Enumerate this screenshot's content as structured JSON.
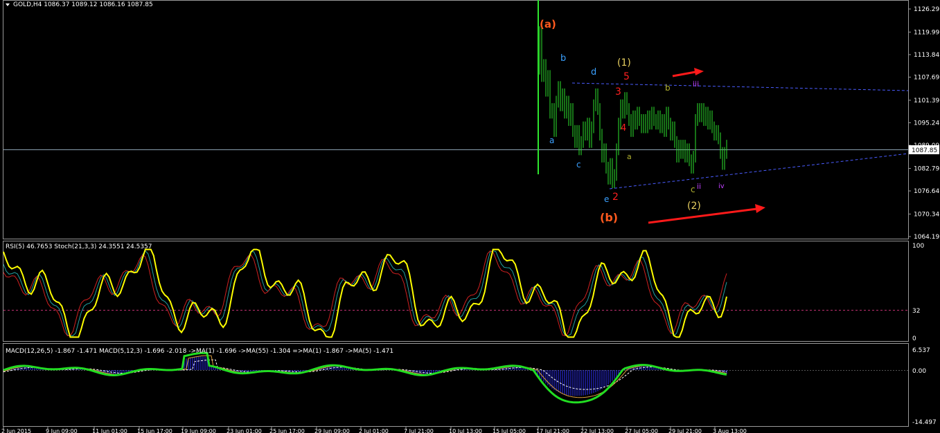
{
  "window": {
    "symbol_header": "GOLD,H4  1086.37 1089.12 1086.16 1087.85"
  },
  "price_panel": {
    "current_price": "1087.85",
    "price_levels": [
      {
        "label": "1126.29",
        "value": 1126.29
      },
      {
        "label": "1119.99",
        "value": 1119.99
      },
      {
        "label": "1113.84",
        "value": 1113.84
      },
      {
        "label": "1107.69",
        "value": 1107.69
      },
      {
        "label": "1101.39",
        "value": 1101.39
      },
      {
        "label": "1095.24",
        "value": 1095.24
      },
      {
        "label": "1089.09",
        "value": 1089.09
      },
      {
        "label": "1082.79",
        "value": 1082.79
      },
      {
        "label": "1076.64",
        "value": 1076.64
      },
      {
        "label": "1070.34",
        "value": 1070.34
      },
      {
        "label": "1064.19",
        "value": 1064.19
      }
    ],
    "wave_labels": [
      {
        "text": "(a)",
        "color": "#ff5a1e"
      },
      {
        "text": "b",
        "color": "#3aa0ff"
      },
      {
        "text": "a",
        "color": "#3aa0ff"
      },
      {
        "text": "d",
        "color": "#3aa0ff"
      },
      {
        "text": "c",
        "color": "#3aa0ff"
      },
      {
        "text": "e",
        "color": "#3aa0ff"
      },
      {
        "text": "(b)",
        "color": "#ff5a1e"
      },
      {
        "text": "(1)",
        "color": "#e8d060"
      },
      {
        "text": "5",
        "color": "#ff2020"
      },
      {
        "text": "3",
        "color": "#ff2020"
      },
      {
        "text": "4",
        "color": "#ff2020"
      },
      {
        "text": "2",
        "color": "#ff2020"
      },
      {
        "text": "a",
        "color": "#b0b030"
      },
      {
        "text": "b",
        "color": "#b0b030"
      },
      {
        "text": "c",
        "color": "#b0b030"
      },
      {
        "text": "iii",
        "color": "#c040ff"
      },
      {
        "text": "ii",
        "color": "#c040ff"
      },
      {
        "text": "iv",
        "color": "#c040ff"
      },
      {
        "text": "(2)",
        "color": "#e8d060"
      }
    ]
  },
  "rsi_panel": {
    "header": "RSI(5) 46.7653  Stoch(21,3,3) 24.3551 24.5357",
    "levels": [
      "100",
      "32",
      "0"
    ]
  },
  "macd_panel": {
    "header": "MACD(12,26,5) -1.867 -1.471  MACD(5,12,3) -1.696 -2.018  ->MA(1) -1.696  ->MA(55) -1.304  =>MA(1) -1.867  ->MA(5) -1.471",
    "levels": [
      "6.537",
      "0.00",
      "-14.497"
    ]
  },
  "time_axis": [
    "2 Jun 2015",
    "9 Jun 09:00",
    "11 Jun 01:00",
    "15 Jun 17:00",
    "19 Jun 09:00",
    "23 Jun 01:00",
    "25 Jun 17:00",
    "29 Jun 09:00",
    "2 Jul 01:00",
    "7 Jul 21:00",
    "10 Jul 13:00",
    "15 Jul 05:00",
    "17 Jul 21:00",
    "22 Jul 13:00",
    "27 Jul 05:00",
    "29 Jul 21:00",
    "3 Aug 13:00"
  ],
  "colors": {
    "candles": "#2ee62e",
    "grid": "#8a8a8a",
    "trendline": "#4a5cff",
    "arrow": "#ff1a1a",
    "rsi": "#ffff00",
    "macd_line": "#22dd22",
    "histogram": "#3232ff"
  }
}
